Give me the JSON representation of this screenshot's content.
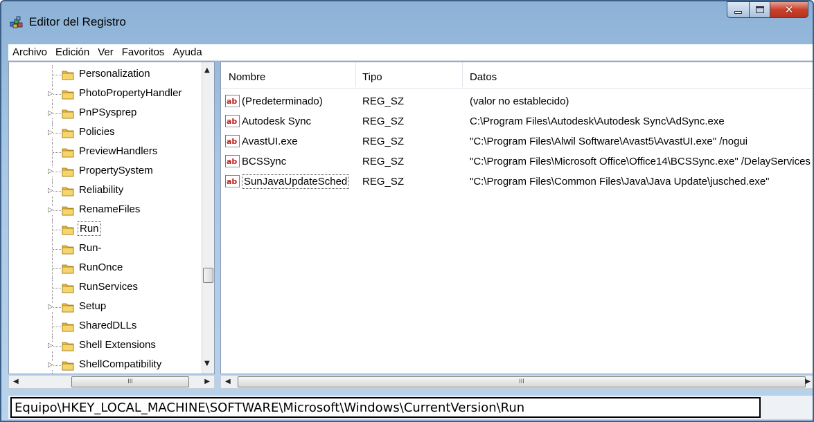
{
  "window": {
    "title": "Editor del Registro",
    "icon": "registry-editor-icon"
  },
  "window_controls": {
    "minimize": "minimize-icon",
    "maximize": "maximize-icon",
    "close": "close-icon"
  },
  "menubar": [
    "Archivo",
    "Edición",
    "Ver",
    "Favoritos",
    "Ayuda"
  ],
  "tree": {
    "items": [
      {
        "label": "Personalization",
        "expandable": false,
        "selected": false
      },
      {
        "label": "PhotoPropertyHandler",
        "expandable": true,
        "selected": false
      },
      {
        "label": "PnPSysprep",
        "expandable": true,
        "selected": false
      },
      {
        "label": "Policies",
        "expandable": true,
        "selected": false
      },
      {
        "label": "PreviewHandlers",
        "expandable": false,
        "selected": false
      },
      {
        "label": "PropertySystem",
        "expandable": true,
        "selected": false
      },
      {
        "label": "Reliability",
        "expandable": true,
        "selected": false
      },
      {
        "label": "RenameFiles",
        "expandable": true,
        "selected": false
      },
      {
        "label": "Run",
        "expandable": false,
        "selected": true
      },
      {
        "label": "Run-",
        "expandable": false,
        "selected": false
      },
      {
        "label": "RunOnce",
        "expandable": false,
        "selected": false
      },
      {
        "label": "RunServices",
        "expandable": false,
        "selected": false
      },
      {
        "label": "Setup",
        "expandable": true,
        "selected": false
      },
      {
        "label": "SharedDLLs",
        "expandable": false,
        "selected": false
      },
      {
        "label": "Shell Extensions",
        "expandable": true,
        "selected": false
      },
      {
        "label": "ShellCompatibility",
        "expandable": true,
        "selected": false
      }
    ],
    "hscroll_thumb_label": "III"
  },
  "list": {
    "columns": {
      "name": "Nombre",
      "type": "Tipo",
      "data": "Datos"
    },
    "rows": [
      {
        "name": "(Predeterminado)",
        "type": "REG_SZ",
        "data": "(valor no establecido)",
        "icon": "reg-sz-icon",
        "selected": false
      },
      {
        "name": "Autodesk Sync",
        "type": "REG_SZ",
        "data": "C:\\Program Files\\Autodesk\\Autodesk Sync\\AdSync.exe",
        "icon": "reg-sz-icon",
        "selected": false
      },
      {
        "name": "AvastUI.exe",
        "type": "REG_SZ",
        "data": "\"C:\\Program Files\\Alwil Software\\Avast5\\AvastUI.exe\" /nogui",
        "icon": "reg-sz-icon",
        "selected": false
      },
      {
        "name": "BCSSync",
        "type": "REG_SZ",
        "data": "\"C:\\Program Files\\Microsoft Office\\Office14\\BCSSync.exe\" /DelayServices",
        "icon": "reg-sz-icon",
        "selected": false
      },
      {
        "name": "SunJavaUpdateSched",
        "type": "REG_SZ",
        "data": "\"C:\\Program Files\\Common Files\\Java\\Java Update\\jusched.exe\"",
        "icon": "reg-sz-icon",
        "selected": true
      }
    ],
    "hscroll_thumb_label": "III"
  },
  "statusbar": {
    "path": "Equipo\\HKEY_LOCAL_MACHINE\\SOFTWARE\\Microsoft\\Windows\\CurrentVersion\\Run"
  }
}
